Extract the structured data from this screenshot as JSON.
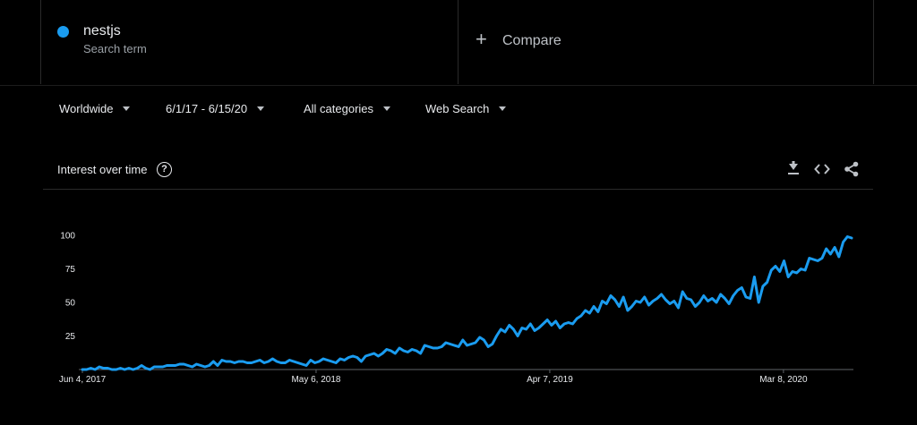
{
  "colors": {
    "background": "#000000",
    "series": "#1a9cf0",
    "axis": "#5f6368",
    "text": "#e8eaed",
    "muted": "#9aa0a6"
  },
  "search_term": {
    "name": "nestjs",
    "subtitle": "Search term",
    "color": "#1a9cf0"
  },
  "compare": {
    "plus_icon": "+",
    "label": "Compare"
  },
  "filters": [
    {
      "label": "Worldwide"
    },
    {
      "label": "6/1/17 - 6/15/20"
    },
    {
      "label": "All categories"
    },
    {
      "label": "Web Search"
    }
  ],
  "card": {
    "title": "Interest over time",
    "help_icon": "?"
  },
  "toolbar": {
    "icons": [
      "download-icon",
      "embed-icon",
      "share-icon"
    ]
  },
  "chart_data": {
    "type": "line",
    "title": "Interest over time",
    "xlabel": "",
    "ylabel": "",
    "ylim": [
      0,
      100
    ],
    "yticks": [
      25,
      50,
      75,
      100
    ],
    "x_range": [
      "2017-06-04",
      "2020-06-14"
    ],
    "x_tick_labels": [
      {
        "label": "Jun 4, 2017",
        "date": "2017-06-04"
      },
      {
        "label": "May 6, 2018",
        "date": "2018-05-06"
      },
      {
        "label": "Apr 7, 2019",
        "date": "2019-04-07"
      },
      {
        "label": "Mar 8, 2020",
        "date": "2020-03-08"
      }
    ],
    "grid": false,
    "legend": "none",
    "series": [
      {
        "name": "nestjs",
        "values": [
          0,
          0,
          1,
          0,
          2,
          1,
          1,
          0,
          0,
          1,
          0,
          1,
          0,
          1,
          3,
          1,
          0,
          2,
          2,
          2,
          3,
          3,
          3,
          4,
          4,
          3,
          2,
          4,
          3,
          2,
          3,
          6,
          3,
          7,
          6,
          6,
          5,
          6,
          6,
          5,
          5,
          6,
          7,
          5,
          6,
          8,
          6,
          5,
          5,
          7,
          6,
          5,
          4,
          3,
          7,
          5,
          6,
          8,
          7,
          6,
          5,
          8,
          7,
          9,
          10,
          9,
          6,
          10,
          11,
          12,
          10,
          12,
          15,
          14,
          12,
          16,
          14,
          13,
          15,
          14,
          12,
          18,
          17,
          16,
          16,
          17,
          20,
          19,
          18,
          17,
          22,
          18,
          19,
          20,
          24,
          22,
          17,
          19,
          25,
          30,
          28,
          33,
          30,
          25,
          31,
          30,
          34,
          29,
          31,
          34,
          37,
          33,
          36,
          31,
          34,
          35,
          34,
          38,
          40,
          44,
          42,
          47,
          43,
          51,
          49,
          55,
          52,
          47,
          54,
          44,
          47,
          51,
          50,
          54,
          48,
          51,
          53,
          56,
          52,
          49,
          51,
          46,
          58,
          53,
          52,
          47,
          50,
          55,
          51,
          53,
          50,
          56,
          53,
          49,
          55,
          59,
          61,
          54,
          53,
          69,
          50,
          62,
          65,
          74,
          77,
          73,
          81,
          69,
          73,
          72,
          75,
          74,
          83,
          82,
          81,
          83,
          90,
          86,
          91,
          84,
          95,
          99,
          98
        ]
      }
    ]
  }
}
